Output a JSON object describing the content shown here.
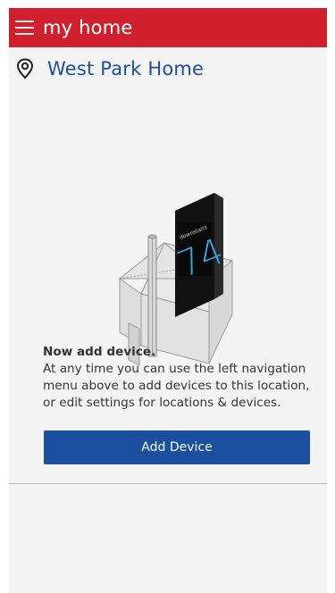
{
  "app_bar": {
    "title": "my home",
    "menu_icon": "hamburger-menu-icon",
    "background_color": "#d0202e"
  },
  "location": {
    "icon": "location-pin-icon",
    "name": "West Park Home"
  },
  "illustration": {
    "thermostat_label": "downstairs",
    "thermostat_reading": "74"
  },
  "message": {
    "headline": "Now add device.",
    "body": "At any time you can use the left navigation menu above to add devices to this location, or edit  settings for locations & devices."
  },
  "add_device_button": {
    "label": "Add Device",
    "color": "#1a4fa0"
  }
}
